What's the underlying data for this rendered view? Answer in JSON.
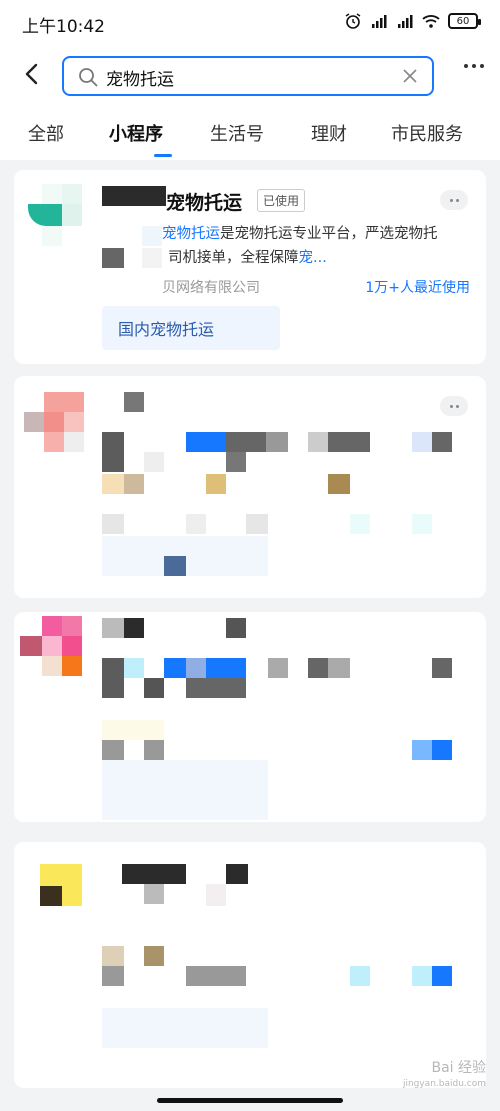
{
  "status_bar": {
    "time": "上午10:42",
    "battery": "60"
  },
  "search": {
    "value": "宠物托运",
    "placeholder": ""
  },
  "tabs": [
    {
      "label": "全部"
    },
    {
      "label": "小程序",
      "active": true
    },
    {
      "label": "生活号"
    },
    {
      "label": "理财"
    },
    {
      "label": "市民服务"
    }
  ],
  "result1": {
    "title": "宠物托运",
    "used_badge": "已使用",
    "desc_highlight1": "宠物托运",
    "desc_text1": "是宠物托运专业平台，严选宠物托",
    "desc_text2": "司机接单，全程保障",
    "desc_highlight2": "宠...",
    "company": "贝网络有限公司",
    "recent_users": "1万+人最近使用",
    "service_tag": "国内宠物托运"
  },
  "watermark": {
    "brand": "Bai 经验",
    "url": "jingyan.baidu.com"
  },
  "colors": {
    "accent": "#1677ff",
    "tag_bg": "#eef5ff",
    "page_bg": "#f2f3f5"
  }
}
